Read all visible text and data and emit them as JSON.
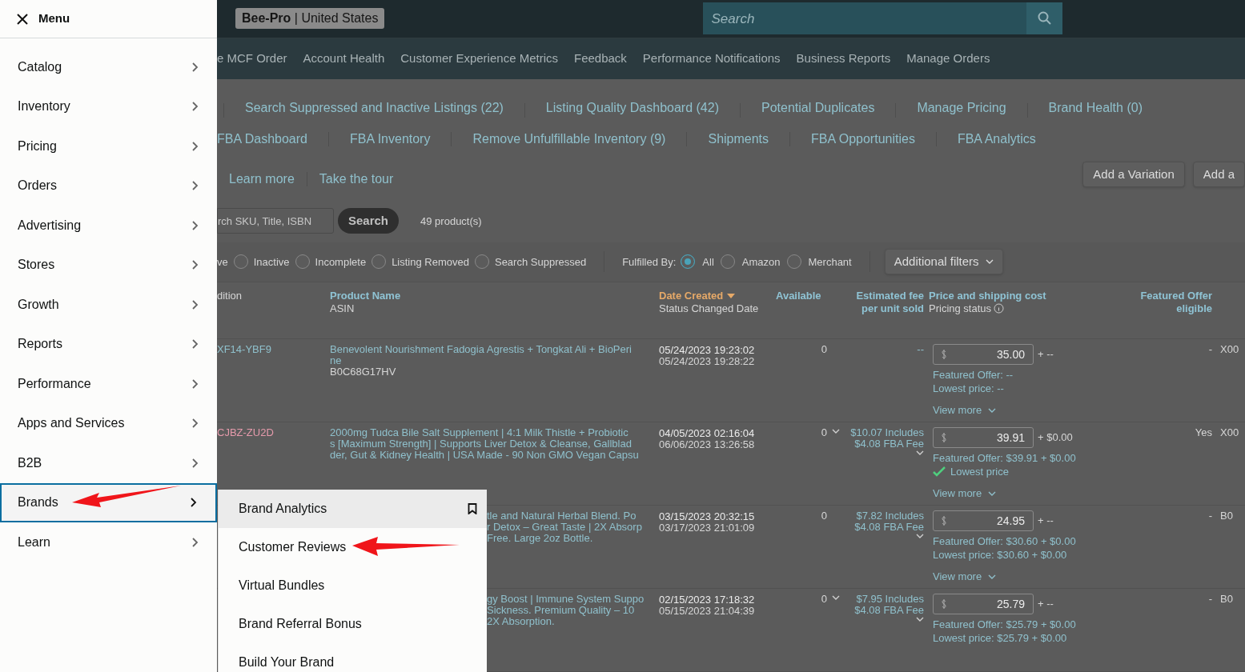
{
  "menu": {
    "title": "Menu",
    "items": [
      {
        "label": "Catalog",
        "selected": false
      },
      {
        "label": "Inventory",
        "selected": false
      },
      {
        "label": "Pricing",
        "selected": false
      },
      {
        "label": "Orders",
        "selected": false
      },
      {
        "label": "Advertising",
        "selected": false
      },
      {
        "label": "Stores",
        "selected": false
      },
      {
        "label": "Growth",
        "selected": false
      },
      {
        "label": "Reports",
        "selected": false
      },
      {
        "label": "Performance",
        "selected": false
      },
      {
        "label": "Apps and Services",
        "selected": false
      },
      {
        "label": "B2B",
        "selected": false
      },
      {
        "label": "Brands",
        "selected": true
      },
      {
        "label": "Learn",
        "selected": false
      }
    ]
  },
  "submenu": {
    "items": [
      {
        "label": "Brand Analytics",
        "selected": true,
        "bookmark": true
      },
      {
        "label": "Customer Reviews",
        "selected": false,
        "bookmark": false
      },
      {
        "label": "Virtual Bundles",
        "selected": false,
        "bookmark": false
      },
      {
        "label": "Brand Referral Bonus",
        "selected": false,
        "bookmark": false
      },
      {
        "label": "Build Your Brand",
        "selected": false,
        "bookmark": false
      }
    ]
  },
  "header": {
    "store": "**Bee-Pro** | United States",
    "search": {
      "placeholder": "Search"
    }
  },
  "nav_links": [
    "e MCF Order",
    "Account Health",
    "Customer Experience Metrics",
    "Feedback",
    "Performance Notifications",
    "Business Reports",
    "Manage Orders"
  ],
  "subnav_1": [
    "Search Suppressed and Inactive Listings (22)",
    "Listing Quality Dashboard (42)",
    "Potential Duplicates",
    "Manage Pricing",
    "Brand Health (0)"
  ],
  "subnav_2": [
    "FBA Dashboard",
    "FBA Inventory",
    "Remove Unfulfillable Inventory (9)",
    "Shipments",
    "FBA Opportunities",
    "FBA Analytics"
  ],
  "help_links": [
    "Learn more",
    "Take the tour"
  ],
  "action_buttons": [
    "Add a Variation",
    "Add a"
  ],
  "listing_search": {
    "placeholder": "rch SKU, Title, ISBN",
    "button": "Search",
    "count": "49 product(s)"
  },
  "status_fragment": "ve",
  "status_filters": [
    {
      "label": "Inactive",
      "selected": false
    },
    {
      "label": "Incomplete",
      "selected": false
    },
    {
      "label": "Listing Removed",
      "selected": false
    },
    {
      "label": "Search Suppressed",
      "selected": false
    }
  ],
  "fulfilled_by": {
    "label": "Fulfilled By:",
    "options": [
      {
        "label": "All",
        "selected": true
      },
      {
        "label": "Amazon",
        "selected": false
      },
      {
        "label": "Merchant",
        "selected": false
      }
    ]
  },
  "additional_filters": "Additional filters",
  "table": {
    "columns": [
      {
        "subtitle": "dition",
        "sorted": false,
        "info": false
      },
      {
        "title": "Product Name",
        "subtitle": "ASIN",
        "sorted": false,
        "info": false
      },
      {
        "title": "Date Created",
        "subtitle": "Status Changed Date",
        "sorted": true,
        "info": false
      },
      {
        "title": "Available",
        "sorted": false,
        "info": false
      },
      {
        "title": "Estimated fee per unit sold",
        "sorted": false,
        "info": false
      },
      {
        "title": "Price and shipping cost",
        "subtitle": "Pricing status",
        "sorted": false,
        "info": true
      },
      {
        "title": "Featured Offer eligible",
        "sorted": false,
        "info": false
      }
    ],
    "rows": [
      {
        "sku": "XF14-YBF9",
        "color": "#8fc0cc",
        "covered": false,
        "product": [
          "Benevolent Nourishment Fadogia Agrestis + Tongkat Ali + BioPeri",
          "ne"
        ],
        "asin": "B0C68G17HV",
        "created": "05/24/2023 19:23:02",
        "changed": "05/24/2023 19:28:22",
        "available": "0",
        "available_menu": false,
        "fee": [
          "--"
        ],
        "fee_menu": false,
        "price": "35.00",
        "shipping": "+ --",
        "featured": "Featured Offer: --",
        "lowest": "Lowest price: --",
        "lowest_ok": false,
        "view_more": "View more",
        "eligible": "-",
        "extra": "X00"
      },
      {
        "sku": "CJBZ-ZU2D",
        "color": "#e59aab",
        "covered": false,
        "product": [
          "2000mg Tudca Bile Salt Supplement | 4:1 Milk Thistle + Probiotic",
          "s [Maximum Strength] | Supports Liver Detox & Cleanse, Gallblad",
          "der, Gut & Kidney Health | USA Made - 90 Non GMO Vegan Capsu"
        ],
        "created": "04/05/2023 02:16:04",
        "changed": "06/06/2023 13:26:58",
        "available": "0",
        "available_menu": true,
        "fee": [
          "$10.07 Includes",
          "$4.08 FBA Fee"
        ],
        "fee_menu": true,
        "price": "39.91",
        "shipping": "+ $0.00",
        "featured": "Featured Offer: $39.91 + $0.00",
        "lowest": "Lowest price",
        "lowest_ok": true,
        "view_more": "View more",
        "eligible": "Yes",
        "extra": "X00"
      },
      {
        "covered": true,
        "product": [
          "tle and Natural Herbal Blend. Po",
          "r Detox – Great Taste | 2X Absorp",
          "Free. Large 2oz Bottle."
        ],
        "created": "03/15/2023 20:32:15",
        "changed": "03/17/2023 21:01:09",
        "available": "0",
        "available_menu": false,
        "fee": [
          "$7.82 Includes",
          "$4.08 FBA Fee"
        ],
        "fee_menu": true,
        "price": "24.95",
        "shipping": "+ --",
        "featured": "Featured Offer: $30.60 + $0.00",
        "lowest": "Lowest price: $30.60 + $0.00",
        "lowest_ok": false,
        "view_more": "View more",
        "eligible": "-",
        "extra": "B0"
      },
      {
        "covered": true,
        "product": [
          "gy Boost | Immune System Suppo",
          "Sickness. Premium Quality – 10",
          "2X Absorption."
        ],
        "created": "02/15/2023 17:18:32",
        "changed": "05/15/2023 21:04:39",
        "available": "0",
        "available_menu": true,
        "fee": [
          "$7.95 Includes",
          "$4.08 FBA Fee"
        ],
        "fee_menu": true,
        "price": "25.79",
        "shipping": "+ --",
        "featured": "Featured Offer: $25.79 + $0.00",
        "lowest": "Lowest price: $25.79 + $0.00",
        "lowest_ok": false,
        "eligible": "-",
        "extra": "B0"
      }
    ]
  }
}
